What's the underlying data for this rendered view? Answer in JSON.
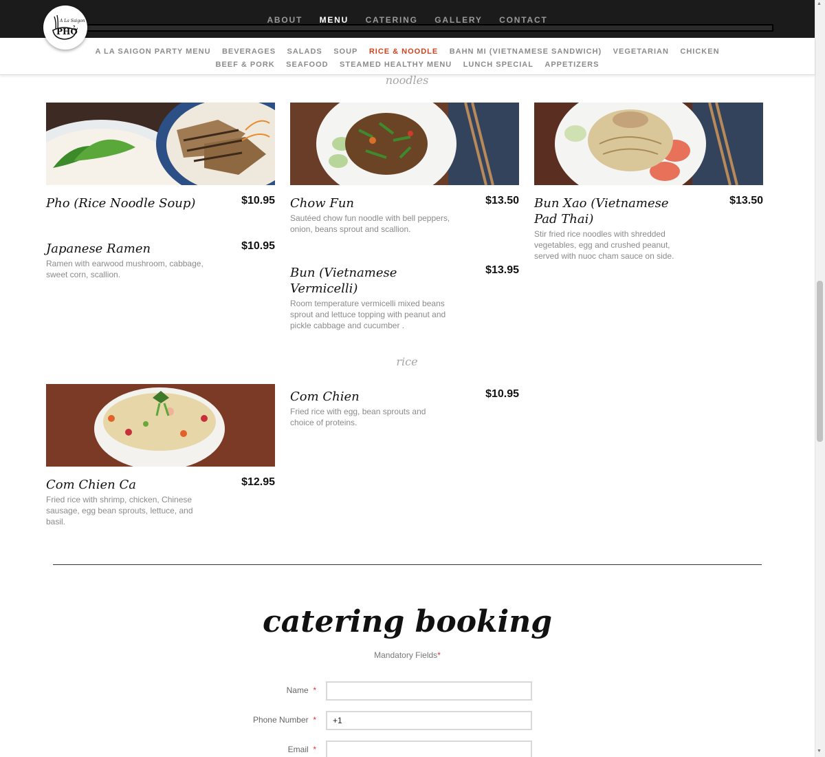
{
  "top_nav": {
    "items": [
      {
        "label": "ABOUT",
        "active": false
      },
      {
        "label": "MENU",
        "active": true
      },
      {
        "label": "CATERING",
        "active": false
      },
      {
        "label": "GALLERY",
        "active": false
      },
      {
        "label": "CONTACT",
        "active": false
      }
    ]
  },
  "logo": {
    "text_small": "A La Saigon",
    "text_big": "PHỞ"
  },
  "sub_nav": {
    "row1": [
      {
        "label": "A LA SAIGON PARTY MENU",
        "active": false
      },
      {
        "label": "BEVERAGES",
        "active": false
      },
      {
        "label": "SALADS",
        "active": false
      },
      {
        "label": "SOUP",
        "active": false
      },
      {
        "label": "RICE & NOODLE",
        "active": true
      },
      {
        "label": "BAHN MI (VIETNAMESE SANDWICH)",
        "active": false
      },
      {
        "label": "VEGETARIAN",
        "active": false
      },
      {
        "label": "CHICKEN",
        "active": false
      }
    ],
    "row2": [
      {
        "label": "BEEF & PORK",
        "active": false
      },
      {
        "label": "SEAFOOD",
        "active": false
      },
      {
        "label": "STEAMED HEALTHY MENU",
        "active": false
      },
      {
        "label": "LUNCH SPECIAL",
        "active": false
      },
      {
        "label": "APPETIZERS",
        "active": false
      }
    ],
    "active_color": "#d2421d"
  },
  "sections": {
    "noodles": "noodles",
    "rice": "rice"
  },
  "items": {
    "pho": {
      "name": "Pho (Rice Noodle Soup)",
      "price": "$10.95"
    },
    "ramen": {
      "name": "Japanese Ramen",
      "price": "$10.95",
      "desc": "Ramen with earwood mushroom, cabbage, sweet corn, scallion."
    },
    "chow_fun": {
      "name": "Chow Fun",
      "price": "$13.50",
      "desc": "Sautéed chow fun noodle with bell peppers, onion, beans sprout and scallion."
    },
    "bun": {
      "name": "Bun (Vietnamese Vermicelli)",
      "price": "$13.95",
      "desc": "Room temperature vermicelli mixed beans sprout and lettuce topping with peanut and pickle cabbage and cucumber ."
    },
    "bun_xao": {
      "name": "Bun Xao (Vietnamese Pad Thai)",
      "price": "$13.50",
      "desc": "Stir fried rice noodles with shredded vegetables, egg and crushed peanut, served with nuoc cham sauce on side."
    },
    "com_chien_ca": {
      "name": "Com Chien Ca",
      "price": "$12.95",
      "desc": "Fried rice with shrimp, chicken, Chinese sausage, egg bean sprouts, lettuce, and basil."
    },
    "com_chien": {
      "name": "Com Chien",
      "price": "$10.95",
      "desc": "Fried rice with egg, bean sprouts and choice of proteins."
    }
  },
  "catering": {
    "title": "catering booking",
    "mandatory_label": "Mandatory Fields",
    "asterisk": "*",
    "fields": {
      "name": {
        "label": "Name",
        "value": ""
      },
      "phone": {
        "label": "Phone Number",
        "value": "+1"
      },
      "email": {
        "label": "Email",
        "value": ""
      }
    }
  }
}
